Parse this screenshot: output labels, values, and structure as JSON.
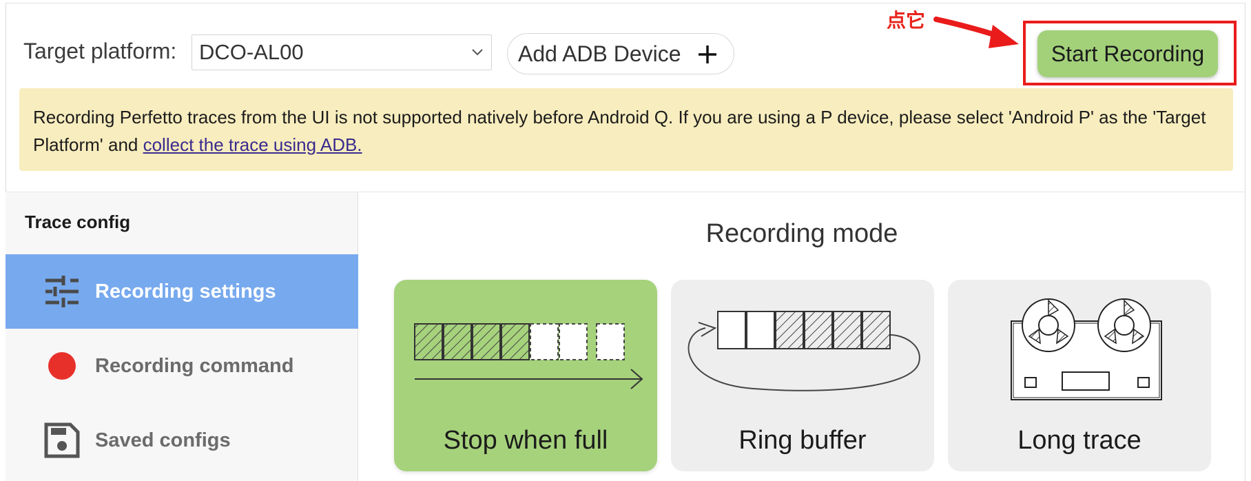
{
  "topbar": {
    "platform_label": "Target platform:",
    "platform_value": "DCO-AL00",
    "add_adb_label": "Add ADB Device",
    "start_recording_label": "Start Recording"
  },
  "annotation": {
    "label": "点它",
    "color": "#ea1b1b"
  },
  "banner": {
    "text": "Recording Perfetto traces from the UI is not supported natively before Android Q. If you are using a P device, please select 'Android P' as the 'Target Platform' and ",
    "link_text": "collect the trace using ADB."
  },
  "sidebar": {
    "title": "Trace config",
    "items": [
      {
        "label": "Recording settings",
        "icon": "sliders-icon",
        "active": true
      },
      {
        "label": "Recording command",
        "icon": "record-dot-icon",
        "active": false
      },
      {
        "label": "Saved configs",
        "icon": "floppy-disk-icon",
        "active": false
      }
    ]
  },
  "main": {
    "title": "Recording mode",
    "modes": [
      {
        "label": "Stop when full",
        "selected": true
      },
      {
        "label": "Ring buffer",
        "selected": false
      },
      {
        "label": "Long trace",
        "selected": false
      }
    ]
  },
  "colors": {
    "accent_green": "#a3d17a",
    "sidebar_active": "#77a9ee",
    "banner_bg": "#f8edbe",
    "record_red": "#e8302a"
  }
}
